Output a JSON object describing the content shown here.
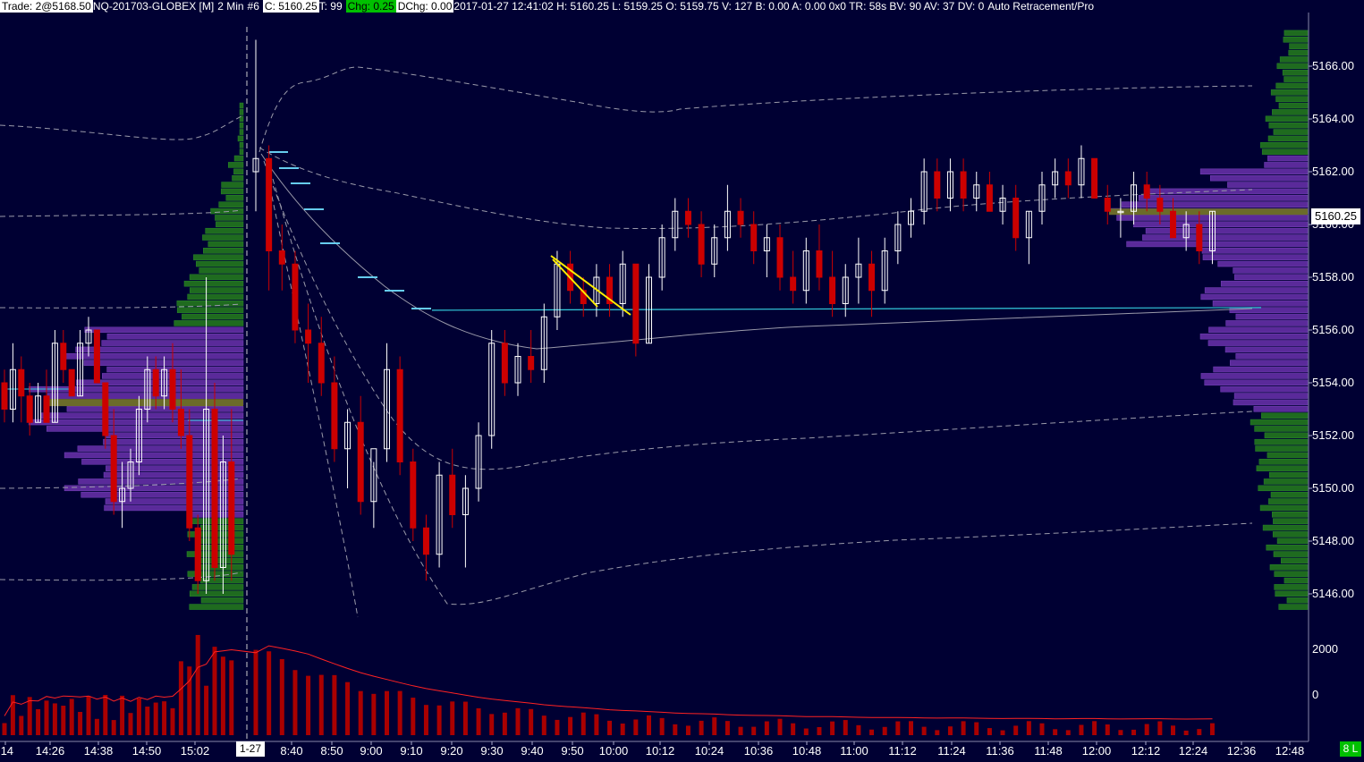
{
  "topbar": {
    "trade": "Trade: 2@5168.50",
    "symbol": "NQ-201703-GLOBEX [M]",
    "interval": "2 Min",
    "hash": "#6",
    "close": "C: 5160.25",
    "ticks": "T: 99",
    "chg": "Chg: 0.25",
    "dchg": "DChg: 0.00",
    "info": "2017-01-27 12:41:02 H: 5160.25 L: 5159.25 O: 5159.75 V: 127 B: 0.00 A: 0.00 0x0 TR: 58s BV: 90 AV: 37 DV: 0",
    "study": "Auto Retracement/Pro"
  },
  "price_axis": {
    "labels": [
      "5166.00",
      "5164.00",
      "5162.00",
      "5160.00",
      "5158.00",
      "5156.00",
      "5154.00",
      "5152.00",
      "5150.00",
      "5148.00",
      "5146.00"
    ],
    "current_price": "5160.25"
  },
  "volume_axis": {
    "labels": [
      "2000",
      "0"
    ]
  },
  "time_axis": {
    "labels": [
      ":14",
      "14:26",
      "14:38",
      "14:50",
      "15:02",
      "1-27",
      "8:40",
      "8:50",
      "9:00",
      "9:10",
      "9:20",
      "9:30",
      "9:40",
      "9:50",
      "10:00",
      "10:12",
      "10:24",
      "10:36",
      "10:48",
      "11:00",
      "11:12",
      "11:24",
      "11:36",
      "11:48",
      "12:00",
      "12:12",
      "12:24",
      "12:36",
      "12:48"
    ],
    "date_marker": "1-27"
  },
  "status_flag": "8 L",
  "colors": {
    "background": "#000033",
    "up_candle": "#ffffff",
    "down_candle": "#cc0000",
    "profile_purple": "#5a2a9a",
    "profile_green": "#1f6b1f",
    "poc_olive": "#6b6b2a",
    "vwap_line": "#9a9aaa",
    "level_line": "#33ccdd",
    "trend_yellow": "#ffee00",
    "volume_bar": "#aa0000"
  },
  "chart_data": {
    "type": "candlestick",
    "symbol": "NQ-201703-GLOBEX",
    "interval": "2 Min",
    "y_range": [
      5145,
      5167.5
    ],
    "current_price": 5160.25,
    "horizontal_level": 5156.75,
    "poc_prior": 5153.25,
    "poc_today": 5160.5,
    "candles": [
      [
        5154.0,
        5154.5,
        5152.5,
        5153.0
      ],
      [
        5153.0,
        5155.5,
        5152.5,
        5154.5
      ],
      [
        5154.5,
        5155.0,
        5152.5,
        5153.5
      ],
      [
        5153.5,
        5154.0,
        5152.0,
        5152.5
      ],
      [
        5152.5,
        5154.0,
        5152.5,
        5153.5
      ],
      [
        5153.5,
        5154.5,
        5152.5,
        5152.5
      ],
      [
        5152.5,
        5156.0,
        5152.5,
        5155.5
      ],
      [
        5155.5,
        5156.0,
        5154.0,
        5154.5
      ],
      [
        5154.5,
        5154.5,
        5153.5,
        5153.5
      ],
      [
        5153.5,
        5156.0,
        5153.5,
        5155.5
      ],
      [
        5155.5,
        5156.5,
        5155.0,
        5156.0
      ],
      [
        5156.0,
        5156.0,
        5154.0,
        5154.0
      ],
      [
        5154.0,
        5154.0,
        5151.5,
        5152.0
      ],
      [
        5152.0,
        5153.0,
        5149.0,
        5149.5
      ],
      [
        5149.5,
        5151.0,
        5148.5,
        5150.0
      ],
      [
        5150.0,
        5151.5,
        5149.5,
        5151.0
      ],
      [
        5151.0,
        5153.5,
        5150.5,
        5153.0
      ],
      [
        5153.0,
        5155.0,
        5152.5,
        5154.5
      ],
      [
        5154.5,
        5155.0,
        5153.0,
        5153.5
      ],
      [
        5153.5,
        5155.0,
        5153.0,
        5154.5
      ],
      [
        5154.5,
        5155.5,
        5152.5,
        5153.0
      ],
      [
        5153.0,
        5154.5,
        5151.5,
        5152.0
      ],
      [
        5152.0,
        5153.0,
        5148.0,
        5148.5
      ],
      [
        5148.5,
        5149.0,
        5146.0,
        5146.5
      ],
      [
        5146.5,
        5158.0,
        5146.0,
        5153.0
      ],
      [
        5153.0,
        5154.0,
        5146.5,
        5147.0
      ],
      [
        5147.0,
        5152.0,
        5146.0,
        5151.0
      ],
      [
        5151.0,
        5153.0,
        5146.5,
        5147.5
      ],
      [
        5162.0,
        5167.0,
        5160.5,
        5162.5
      ],
      [
        5162.5,
        5163.0,
        5157.5,
        5159.0
      ],
      [
        5159.0,
        5160.0,
        5157.5,
        5158.5
      ],
      [
        5158.5,
        5159.0,
        5155.5,
        5156.0
      ],
      [
        5156.0,
        5157.0,
        5154.0,
        5155.5
      ],
      [
        5155.5,
        5156.5,
        5153.5,
        5154.0
      ],
      [
        5154.0,
        5155.0,
        5151.0,
        5151.5
      ],
      [
        5151.5,
        5153.0,
        5150.0,
        5152.5
      ],
      [
        5152.5,
        5153.5,
        5149.0,
        5149.5
      ],
      [
        5149.5,
        5151.0,
        5148.5,
        5151.5
      ],
      [
        5151.5,
        5155.5,
        5151.0,
        5154.5
      ],
      [
        5154.5,
        5155.0,
        5150.5,
        5151.0
      ],
      [
        5151.0,
        5151.5,
        5148.0,
        5148.5
      ],
      [
        5148.5,
        5149.0,
        5146.5,
        5147.5
      ],
      [
        5147.5,
        5151.0,
        5147.0,
        5150.5
      ],
      [
        5150.5,
        5151.5,
        5148.5,
        5149.0
      ],
      [
        5149.0,
        5150.5,
        5147.0,
        5150.0
      ],
      [
        5150.0,
        5152.5,
        5149.5,
        5152.0
      ],
      [
        5152.0,
        5156.0,
        5151.5,
        5155.5
      ],
      [
        5155.5,
        5156.0,
        5153.5,
        5154.0
      ],
      [
        5154.0,
        5155.5,
        5153.5,
        5155.0
      ],
      [
        5155.0,
        5156.0,
        5154.0,
        5154.5
      ],
      [
        5154.5,
        5157.0,
        5154.0,
        5156.5
      ],
      [
        5156.5,
        5159.0,
        5156.0,
        5158.5
      ],
      [
        5158.5,
        5159.0,
        5157.0,
        5157.5
      ],
      [
        5157.5,
        5158.0,
        5156.5,
        5157.0
      ],
      [
        5157.0,
        5158.5,
        5156.5,
        5158.0
      ],
      [
        5158.0,
        5158.5,
        5156.5,
        5157.0
      ],
      [
        5157.0,
        5159.0,
        5156.5,
        5158.5
      ],
      [
        5158.5,
        5158.5,
        5155.0,
        5155.5
      ],
      [
        5155.5,
        5158.5,
        5155.5,
        5158.0
      ],
      [
        5158.0,
        5160.0,
        5157.5,
        5159.5
      ],
      [
        5159.5,
        5161.0,
        5159.0,
        5160.5
      ],
      [
        5160.5,
        5161.0,
        5159.5,
        5160.0
      ],
      [
        5160.0,
        5160.5,
        5158.0,
        5158.5
      ],
      [
        5158.5,
        5160.0,
        5158.0,
        5159.5
      ],
      [
        5159.5,
        5161.5,
        5159.0,
        5160.5
      ],
      [
        5160.5,
        5161.0,
        5159.5,
        5160.0
      ],
      [
        5160.0,
        5160.5,
        5158.5,
        5159.0
      ],
      [
        5159.0,
        5160.0,
        5158.0,
        5159.5
      ],
      [
        5159.5,
        5160.0,
        5157.5,
        5158.0
      ],
      [
        5158.0,
        5159.0,
        5157.0,
        5157.5
      ],
      [
        5157.5,
        5159.5,
        5157.0,
        5159.0
      ],
      [
        5159.0,
        5160.0,
        5157.5,
        5158.0
      ],
      [
        5158.0,
        5159.0,
        5156.5,
        5157.0
      ],
      [
        5157.0,
        5158.5,
        5156.5,
        5158.0
      ],
      [
        5158.0,
        5159.5,
        5157.0,
        5158.5
      ],
      [
        5158.5,
        5159.0,
        5156.5,
        5157.5
      ],
      [
        5157.5,
        5159.5,
        5157.0,
        5159.0
      ],
      [
        5159.0,
        5160.5,
        5158.5,
        5160.0
      ],
      [
        5160.0,
        5161.0,
        5159.5,
        5160.5
      ],
      [
        5160.5,
        5162.5,
        5160.0,
        5162.0
      ],
      [
        5162.0,
        5162.5,
        5160.5,
        5161.0
      ],
      [
        5161.0,
        5162.5,
        5160.5,
        5162.0
      ],
      [
        5162.0,
        5162.5,
        5160.5,
        5161.0
      ],
      [
        5161.0,
        5162.0,
        5160.5,
        5161.5
      ],
      [
        5161.5,
        5162.0,
        5160.5,
        5160.5
      ],
      [
        5160.5,
        5161.5,
        5160.0,
        5161.0
      ],
      [
        5161.0,
        5161.5,
        5159.0,
        5159.5
      ],
      [
        5159.5,
        5160.5,
        5158.5,
        5160.5
      ],
      [
        5160.5,
        5162.0,
        5160.0,
        5161.5
      ],
      [
        5161.5,
        5162.5,
        5161.0,
        5162.0
      ],
      [
        5162.0,
        5162.5,
        5161.0,
        5161.5
      ],
      [
        5161.5,
        5163.0,
        5161.0,
        5162.5
      ],
      [
        5162.5,
        5162.5,
        5161.0,
        5161.0
      ],
      [
        5161.0,
        5161.5,
        5160.0,
        5160.5
      ],
      [
        5160.5,
        5161.0,
        5159.5,
        5160.5
      ],
      [
        5160.5,
        5162.0,
        5160.0,
        5161.5
      ],
      [
        5161.5,
        5162.0,
        5160.5,
        5161.0
      ],
      [
        5161.0,
        5161.5,
        5160.0,
        5160.5
      ],
      [
        5160.5,
        5161.0,
        5159.5,
        5159.5
      ],
      [
        5159.5,
        5160.5,
        5159.0,
        5160.0
      ],
      [
        5160.0,
        5160.5,
        5158.5,
        5159.0
      ],
      [
        5159.0,
        5160.5,
        5158.5,
        5160.5
      ]
    ]
  }
}
